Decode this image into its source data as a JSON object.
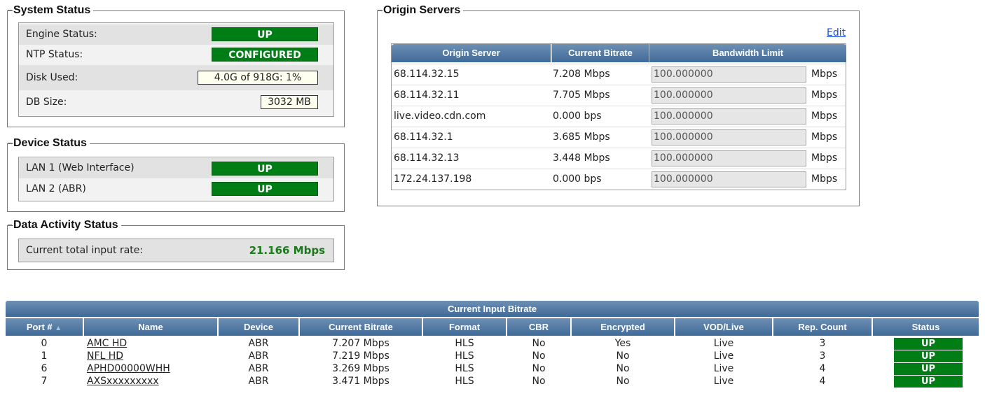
{
  "system_status": {
    "title": "System Status",
    "rows": [
      {
        "label": "Engine Status:",
        "value": "UP"
      },
      {
        "label": "NTP Status:",
        "value": "CONFIGURED"
      },
      {
        "label": "Disk Used:",
        "value": "4.0G of 918G: 1%"
      },
      {
        "label": "DB Size:",
        "value": "3032 MB"
      }
    ]
  },
  "device_status": {
    "title": "Device Status",
    "rows": [
      {
        "label": "LAN 1 (Web Interface)",
        "value": "UP"
      },
      {
        "label": "LAN 2 (ABR)",
        "value": "UP"
      }
    ]
  },
  "data_activity": {
    "title": "Data Activity Status",
    "label": "Current total input rate:",
    "value": "21.166 Mbps"
  },
  "origin_servers": {
    "title": "Origin Servers",
    "edit_label": "Edit",
    "headers": [
      "Origin Server",
      "Current Bitrate",
      "Bandwidth Limit"
    ],
    "unit": "Mbps",
    "rows": [
      {
        "server": "68.114.32.15",
        "bitrate": "7.208 Mbps",
        "limit": "100.000000"
      },
      {
        "server": "68.114.32.11",
        "bitrate": "7.705 Mbps",
        "limit": "100.000000"
      },
      {
        "server": "live.video.cdn.com",
        "bitrate": "0.000 bps",
        "limit": "100.000000"
      },
      {
        "server": "68.114.32.1",
        "bitrate": "3.685 Mbps",
        "limit": "100.000000"
      },
      {
        "server": "68.114.32.13",
        "bitrate": "3.448 Mbps",
        "limit": "100.000000"
      },
      {
        "server": "172.24.137.198",
        "bitrate": "0.000 bps",
        "limit": "100.000000"
      }
    ]
  },
  "input_bitrate": {
    "title": "Current Input Bitrate",
    "headers": [
      "Port #",
      "Name",
      "Device",
      "Current Bitrate",
      "Format",
      "CBR",
      "Encrypted",
      "VOD/Live",
      "Rep. Count",
      "Status"
    ],
    "sort_icon": "sort-ascending-icon",
    "rows": [
      {
        "port": "0",
        "name": "AMC HD",
        "device": "ABR",
        "bitrate": "7.207 Mbps",
        "format": "HLS",
        "cbr": "No",
        "encrypted": "Yes",
        "vodlive": "Live",
        "rep": "3",
        "status": "UP"
      },
      {
        "port": "1",
        "name": "NFL HD",
        "device": "ABR",
        "bitrate": "7.219 Mbps",
        "format": "HLS",
        "cbr": "No",
        "encrypted": "No",
        "vodlive": "Live",
        "rep": "3",
        "status": "UP"
      },
      {
        "port": "6",
        "name": "APHD00000WHH",
        "device": "ABR",
        "bitrate": "3.269 Mbps",
        "format": "HLS",
        "cbr": "No",
        "encrypted": "No",
        "vodlive": "Live",
        "rep": "4",
        "status": "UP"
      },
      {
        "port": "7",
        "name": "AXSxxxxxxxxx",
        "device": "ABR",
        "bitrate": "3.471 Mbps",
        "format": "HLS",
        "cbr": "No",
        "encrypted": "No",
        "vodlive": "Live",
        "rep": "4",
        "status": "UP"
      }
    ]
  },
  "colors": {
    "status_up": "#007d14",
    "header_blue": "#3f6a98",
    "value_green": "#1b7a1b"
  }
}
